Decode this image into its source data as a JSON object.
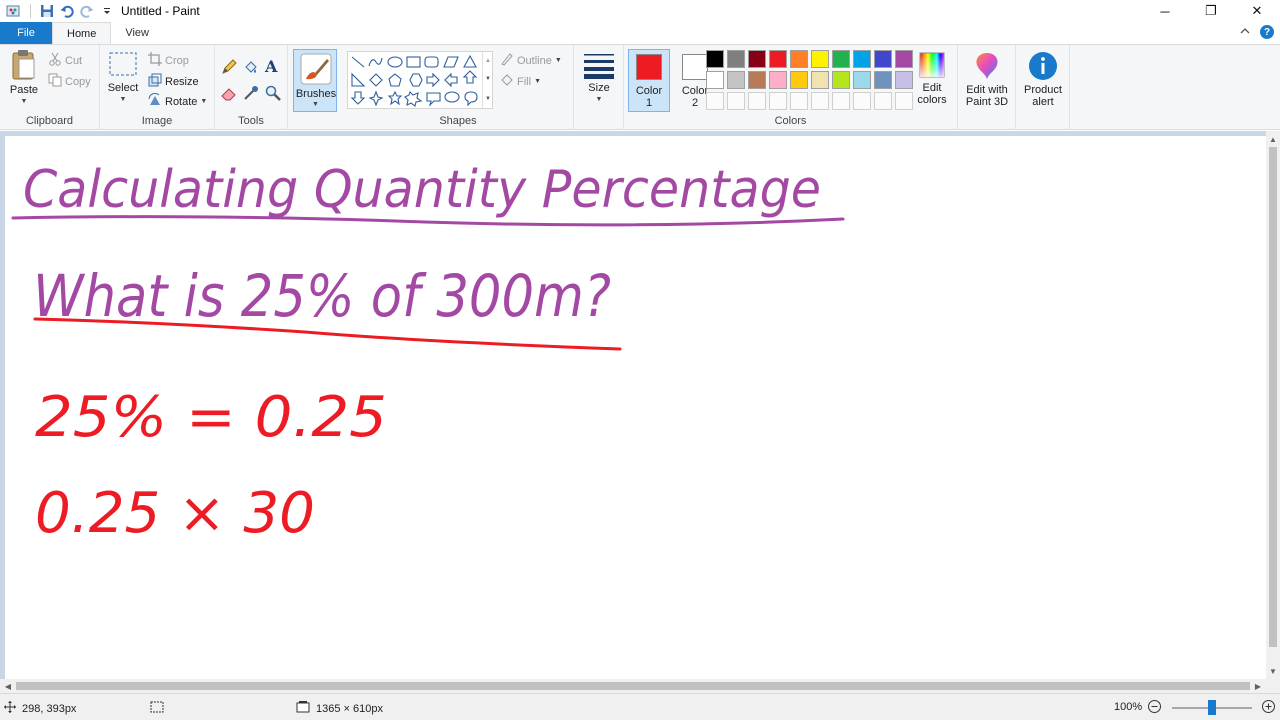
{
  "window": {
    "title": "Untitled - Paint",
    "minimize": "─",
    "maximize": "❐",
    "close": "✕"
  },
  "tabs": [
    {
      "label": "File"
    },
    {
      "label": "Home"
    },
    {
      "label": "View"
    }
  ],
  "ribbon": {
    "clipboard": {
      "label": "Clipboard",
      "paste": "Paste",
      "cut": "Cut",
      "copy": "Copy"
    },
    "image": {
      "label": "Image",
      "select": "Select",
      "crop": "Crop",
      "resize": "Resize",
      "rotate": "Rotate"
    },
    "tools": {
      "label": "Tools"
    },
    "brushes": {
      "label": "Brushes"
    },
    "shapes": {
      "label": "Shapes",
      "outline": "Outline",
      "fill": "Fill"
    },
    "size": {
      "label": "Size"
    },
    "colors": {
      "label": "Colors",
      "color1": {
        "label_a": "Color",
        "label_b": "1",
        "value": "#ed1c24"
      },
      "color2": {
        "label_a": "Color",
        "label_b": "2",
        "value": "#ffffff"
      },
      "edit_colors_a": "Edit",
      "edit_colors_b": "colors",
      "palette_row1": [
        "#000000",
        "#7f7f7f",
        "#880015",
        "#ed1c24",
        "#ff7f27",
        "#fff200",
        "#22b14c",
        "#00a2e8",
        "#3f48cc",
        "#a349a4"
      ],
      "palette_row2": [
        "#ffffff",
        "#c3c3c3",
        "#b97a57",
        "#ffaec9",
        "#ffc90e",
        "#efe4b0",
        "#b5e61d",
        "#99d9ea",
        "#7092be",
        "#c8bfe7"
      ]
    },
    "paint3d": {
      "label_a": "Edit with",
      "label_b": "Paint 3D"
    },
    "product_alert": {
      "label_a": "Product",
      "label_b": "alert"
    }
  },
  "canvas_text": {
    "title": "Calculating Quantity Percentage",
    "question": "What is 25% of 300m?",
    "step1": "25% = 0.25",
    "step2": "0.25 × 30"
  },
  "status": {
    "cursor_pos": "298, 393px",
    "canvas_size": "1365 × 610px",
    "zoom": "100%"
  }
}
